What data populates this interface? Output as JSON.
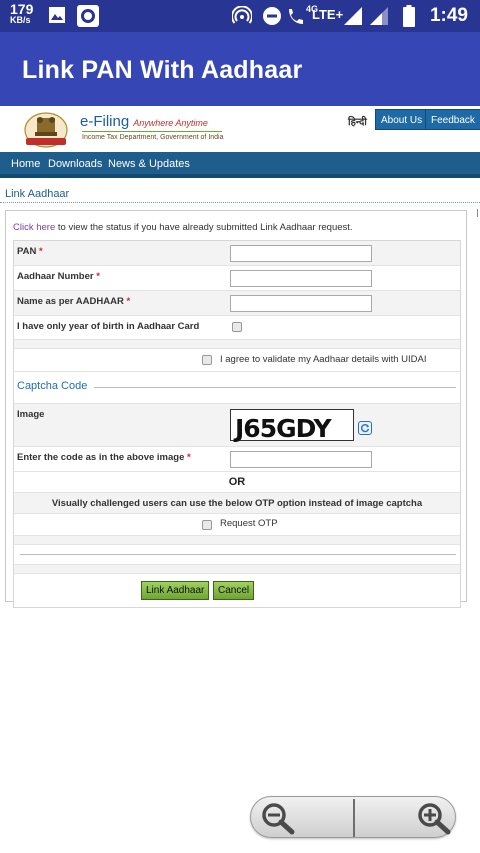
{
  "status_bar": {
    "net_speed_value": "179",
    "net_speed_unit": "KB/s",
    "network_type": "4G",
    "lte_label": "LTE+",
    "time": "1:49",
    "icons": [
      "image-icon",
      "record-icon",
      "hotspot-icon",
      "do-not-disturb-icon",
      "wifi-calling-icon",
      "signal-icon",
      "signal-icon",
      "battery-icon"
    ]
  },
  "app_bar": {
    "title": "Link PAN With Aadhaar",
    "color": "#3646b5"
  },
  "site_header": {
    "brand": "e-Filing",
    "tagline": "Anywhere Anytime",
    "subtitle": "Income Tax Department, Government of India",
    "language_link": "हिन्दी",
    "buttons": [
      "About Us",
      "Feedback"
    ]
  },
  "nav": {
    "items": [
      "Home",
      "Downloads",
      "News & Updates"
    ]
  },
  "page": {
    "section_title": "Link Aadhaar",
    "status_link": "Click here",
    "status_text": " to view the status if you have already submitted Link Aadhaar request."
  },
  "form": {
    "pan_label": "PAN",
    "aadhaar_label": "Aadhaar Number",
    "name_label": "Name as per AADHAAR",
    "yob_label": "I have only year of birth in Aadhaar Card",
    "agree_label": "I agree to validate my Aadhaar details with UIDAI",
    "required_mark": "*",
    "pan_value": "",
    "aadhaar_value": "",
    "name_value": ""
  },
  "captcha": {
    "heading": "Captcha Code",
    "image_label": "Image",
    "captcha_text": "J65GDY",
    "code_label": "Enter the code as in the above image",
    "code_value": "",
    "or_text": "OR",
    "otp_hint": "Visually challenged users can use the below OTP option instead of image captcha",
    "otp_label": "Request OTP"
  },
  "actions": {
    "submit_label": "Link Aadhaar",
    "cancel_label": "Cancel"
  },
  "zoom": {
    "zoom_out": "zoom-out-icon",
    "zoom_in": "zoom-in-icon"
  }
}
